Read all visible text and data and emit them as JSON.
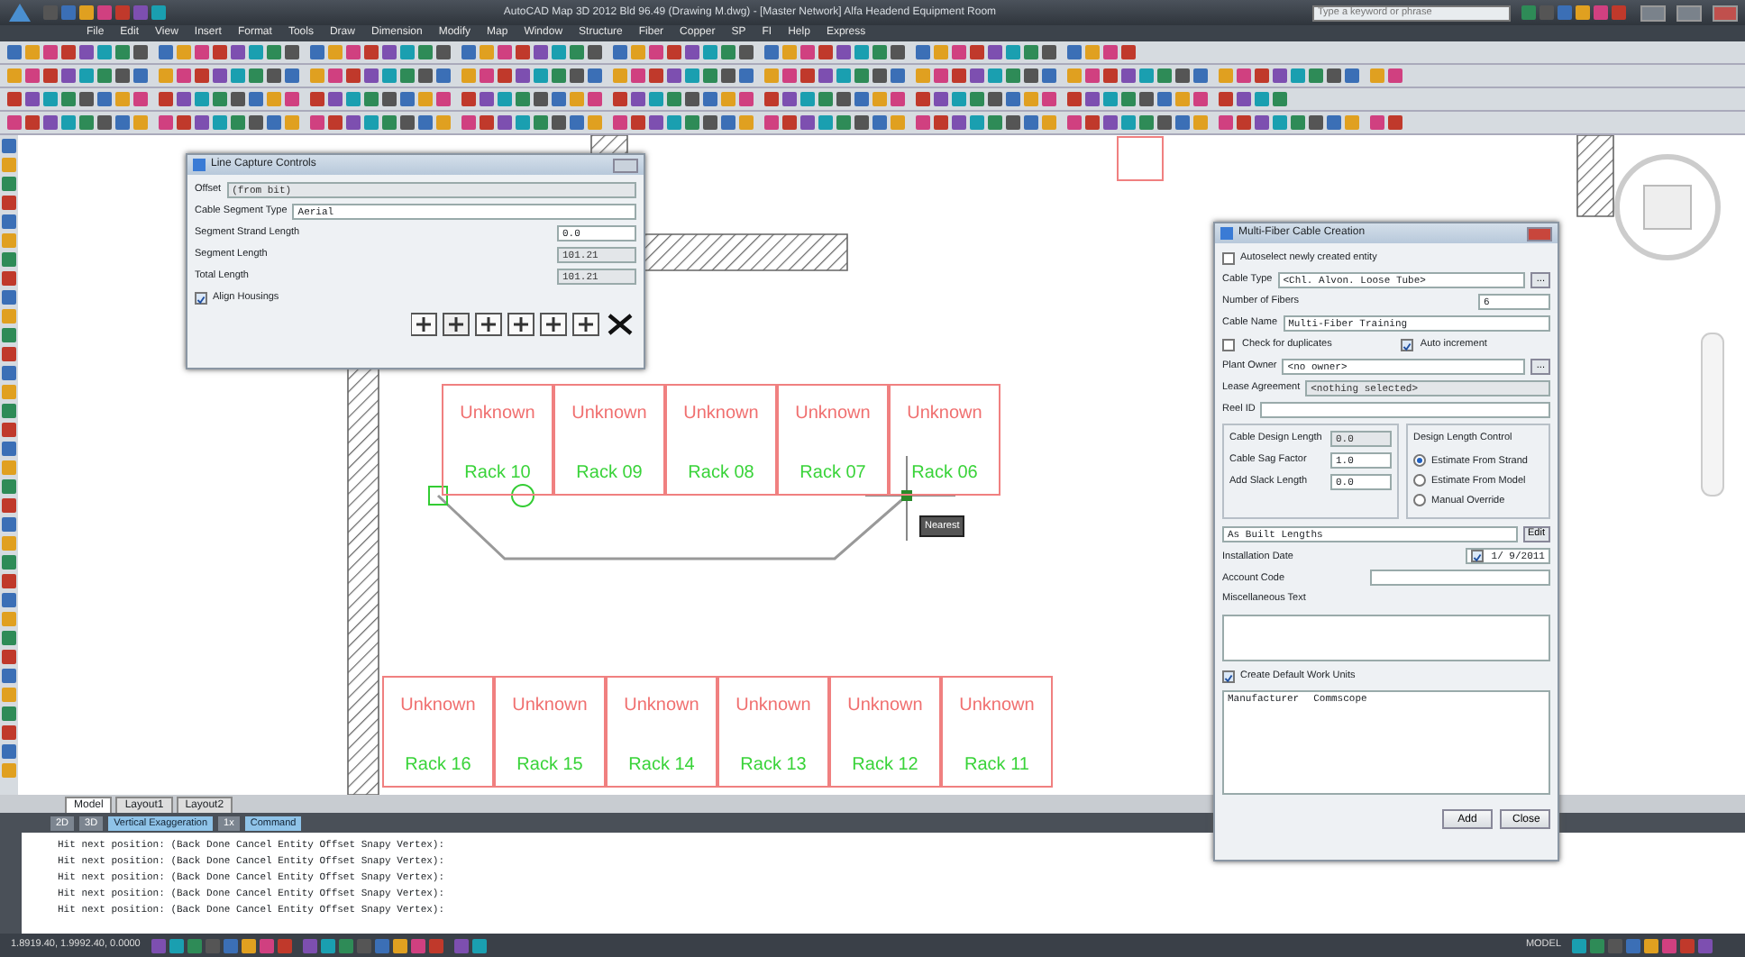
{
  "window": {
    "title": "AutoCAD Map 3D 2012  Bld 96.49  (Drawing M.dwg) - [Master Network] Alfa Headend Equipment Room",
    "search_placeholder": "Type a keyword or phrase"
  },
  "menu": [
    "File",
    "Edit",
    "View",
    "Insert",
    "Format",
    "Tools",
    "Draw",
    "Dimension",
    "Modify",
    "Map",
    "Window",
    "Structure",
    "Fiber",
    "Copper",
    "SP",
    "FI",
    "Help",
    "Express"
  ],
  "drawing": {
    "racks_top": [
      {
        "name": "Rack 10",
        "status": "Unknown"
      },
      {
        "name": "Rack 09",
        "status": "Unknown"
      },
      {
        "name": "Rack 08",
        "status": "Unknown"
      },
      {
        "name": "Rack 07",
        "status": "Unknown"
      },
      {
        "name": "Rack 06",
        "status": "Unknown"
      }
    ],
    "racks_bottom": [
      {
        "name": "Rack 16",
        "status": "Unknown"
      },
      {
        "name": "Rack 15",
        "status": "Unknown"
      },
      {
        "name": "Rack 14",
        "status": "Unknown"
      },
      {
        "name": "Rack 13",
        "status": "Unknown"
      },
      {
        "name": "Rack 12",
        "status": "Unknown"
      },
      {
        "name": "Rack 11",
        "status": "Unknown"
      }
    ],
    "tooltip": "Nearest"
  },
  "line_capture": {
    "title": "Line Capture Controls",
    "fields": [
      {
        "kind": "select",
        "label": "Offset",
        "value": "(from bit)",
        "disabled": true
      },
      {
        "kind": "select",
        "label": "Cable Segment Type",
        "value": "Aerial",
        "disabled": false
      },
      {
        "kind": "number",
        "label": "Segment Strand Length",
        "value": "0.0",
        "disabled": false
      },
      {
        "kind": "number",
        "label": "Segment Length",
        "value": "101.21",
        "disabled": true
      },
      {
        "kind": "number",
        "label": "Total Length",
        "value": "101.21",
        "disabled": true
      },
      {
        "kind": "check",
        "label": "Align Housings",
        "checked": true
      }
    ]
  },
  "multi_fiber": {
    "title": "Multi-Fiber Cable Creation",
    "rows": [
      {
        "kind": "check",
        "label": "Autoselect newly created entity",
        "checked": false
      },
      {
        "kind": "select",
        "label": "Cable Type",
        "value": "<Chl. Alvon. Loose Tube>",
        "button": "..."
      },
      {
        "kind": "number",
        "label": "Number of Fibers",
        "value": "6"
      },
      {
        "kind": "text",
        "label": "Cable Name",
        "value": "Multi-Fiber Training"
      },
      {
        "kind": "check_pair",
        "items": [
          {
            "label": "Check for duplicates",
            "checked": false
          },
          {
            "label": "Auto increment",
            "checked": true
          }
        ]
      },
      {
        "kind": "select",
        "label": "Plant Owner",
        "value": "<no owner>",
        "button": "..."
      },
      {
        "kind": "select",
        "label": "Lease Agreement",
        "value": "<nothing selected>",
        "disabled": true
      },
      {
        "kind": "text",
        "label": "Reel ID"
      }
    ],
    "lengths": [
      {
        "label": "Cable Design Length",
        "value": "0.0",
        "disabled": true
      },
      {
        "label": "Cable Sag Factor",
        "value": "1.0",
        "disabled": false
      },
      {
        "label": "Add Slack Length",
        "value": "0.0",
        "disabled": false
      }
    ],
    "length_control": {
      "title": "Design Length Control",
      "options": [
        {
          "label": "Estimate From Strand",
          "selected": true
        },
        {
          "label": "Estimate From Model",
          "selected": false
        },
        {
          "label": "Manual Override",
          "selected": false
        }
      ]
    },
    "as_built": {
      "value": "As Built Lengths",
      "button": "Edit"
    },
    "installation_date": {
      "label": "Installation Date",
      "value": "1/ 9/2011",
      "checked": true
    },
    "account_code": {
      "label": "Account Code"
    },
    "misc_text": {
      "label": "Miscellaneous Text"
    },
    "work_units": {
      "label": "Create Default Work Units",
      "checked": true,
      "columns": [
        "Manufacturer",
        "Commscope"
      ]
    },
    "buttons": [
      "Add",
      "Close"
    ]
  },
  "layout_tabs": [
    {
      "label": "Model",
      "selected": true
    },
    {
      "label": "Layout1",
      "selected": false
    },
    {
      "label": "Layout2",
      "selected": false
    }
  ],
  "status_tabs": [
    {
      "label": "2D",
      "selected": false
    },
    {
      "label": "3D",
      "selected": false
    },
    {
      "label": "Vertical Exaggeration",
      "selected": true
    },
    {
      "label": "1x",
      "selected": false
    },
    {
      "label": "Command",
      "selected": true
    }
  ],
  "command_history": [
    "Hit next position: (Back Done Cancel Entity Offset Snapy Vertex):",
    "Hit next position: (Back Done Cancel Entity Offset Snapy Vertex):",
    "Hit next position: (Back Done Cancel Entity Offset Snapy Vertex):",
    "Hit next position: (Back Done Cancel Entity Offset Snapy Vertex):",
    "Hit next position: (Back Done Cancel Entity Offset Snapy Vertex):"
  ],
  "status_bar": {
    "coordinates": "1.8919.40, 1.9992.40, 0.0000",
    "mode": "MODEL"
  }
}
